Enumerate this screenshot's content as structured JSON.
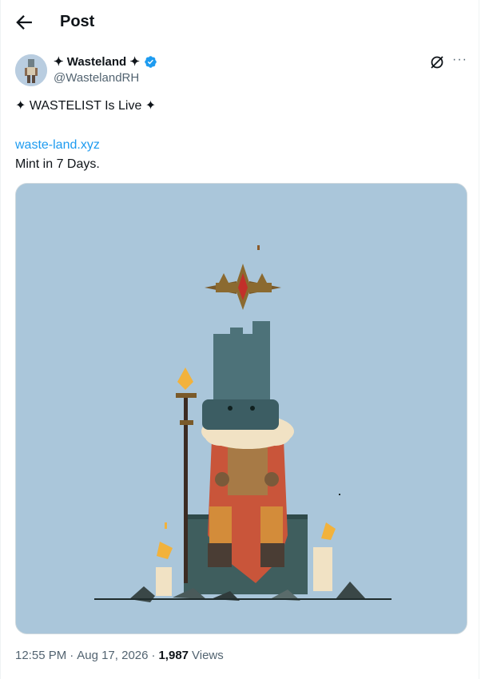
{
  "header": {
    "title": "Post",
    "back_icon": "arrow-left-icon"
  },
  "author": {
    "display_name": "✦ Wasteland ✦",
    "handle": "@WastelandRH",
    "verified_color": "#1d9bf0",
    "avatar_icon": "wasteland-character-avatar"
  },
  "actions": {
    "grok_icon": "slashed-circle-icon",
    "more_label": "···"
  },
  "tweet": {
    "line1": "✦ WASTELIST Is Live ✦",
    "link": "waste-land.xyz",
    "line3": "Mint in 7 Days."
  },
  "media": {
    "background": "#aac6da",
    "description_icon": "throne-king-illustration"
  },
  "meta": {
    "time": "12:55 PM",
    "date": "Aug 17, 2026",
    "dot": "·",
    "views_count": "1,987",
    "views_label": "Views"
  },
  "colors": {
    "accent": "#1d9bf0",
    "muted": "#536471",
    "text": "#0f1419"
  }
}
